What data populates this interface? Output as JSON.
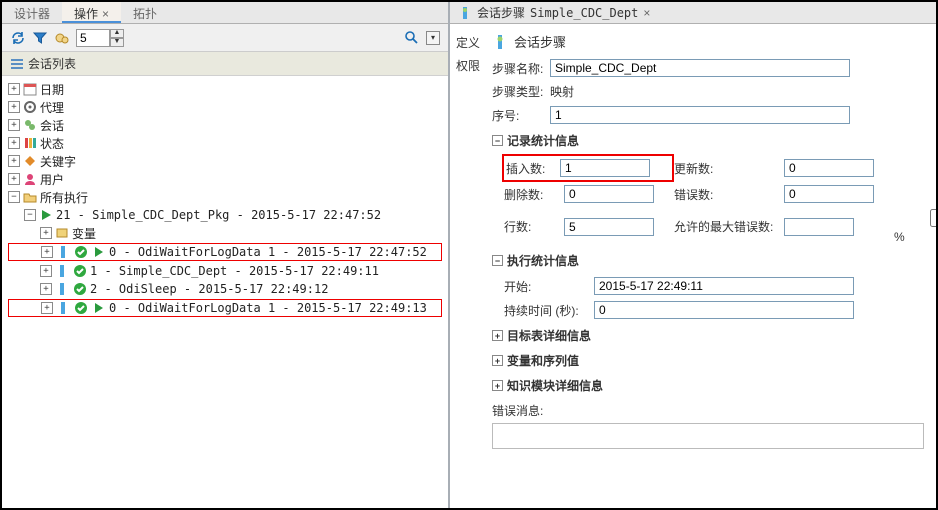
{
  "left": {
    "tabs": [
      "设计器",
      "操作",
      "拓扑"
    ],
    "active_tab": 1,
    "spinner_value": "5",
    "list_header": "会话列表",
    "nodes": {
      "date": "日期",
      "agent": "代理",
      "session": "会话",
      "status": "状态",
      "keyword": "关键字",
      "user": "用户",
      "all_exec": "所有执行",
      "pkg": "21 - Simple_CDC_Dept_Pkg - 2015-5-17 22:47:52",
      "var": "变量",
      "step0a": "0 - OdiWaitForLogData 1 - 2015-5-17 22:47:52",
      "step1": "1 - Simple_CDC_Dept - 2015-5-17 22:49:11",
      "step2": "2 - OdiSleep - 2015-5-17 22:49:12",
      "step0b": "0 - OdiWaitForLogData 1 - 2015-5-17 22:49:13"
    }
  },
  "right": {
    "tab_prefix": "会话步骤",
    "tab_name": "Simple_CDC_Dept",
    "nav": {
      "def": "定义",
      "perm": "权限"
    },
    "title": "会话步骤",
    "fields": {
      "step_name_label": "步骤名称:",
      "step_name": "Simple_CDC_Dept",
      "step_type_label": "步骤类型:",
      "step_type": "映射",
      "seq_label": "序号:",
      "seq": "1"
    },
    "groups": {
      "record_stats": "记录统计信息",
      "exec_stats": "执行统计信息",
      "target_detail": "目标表详细信息",
      "var_seq": "变量和序列值",
      "knowledge": "知识模块详细信息"
    },
    "stats": {
      "insert_label": "插入数:",
      "insert": "1",
      "update_label": "更新数:",
      "update": "0",
      "delete_label": "删除数:",
      "delete": "0",
      "error_label": "错误数:",
      "error": "0",
      "rows_label": "行数:",
      "rows": "5",
      "maxerr_label": "允许的最大错误数:",
      "maxerr": "",
      "pct": "%"
    },
    "exec": {
      "start_label": "开始:",
      "start": "2015-5-17 22:49:11",
      "dur_label": "持续时间 (秒):",
      "dur": "0"
    },
    "error_msg_label": "错误消息:"
  }
}
